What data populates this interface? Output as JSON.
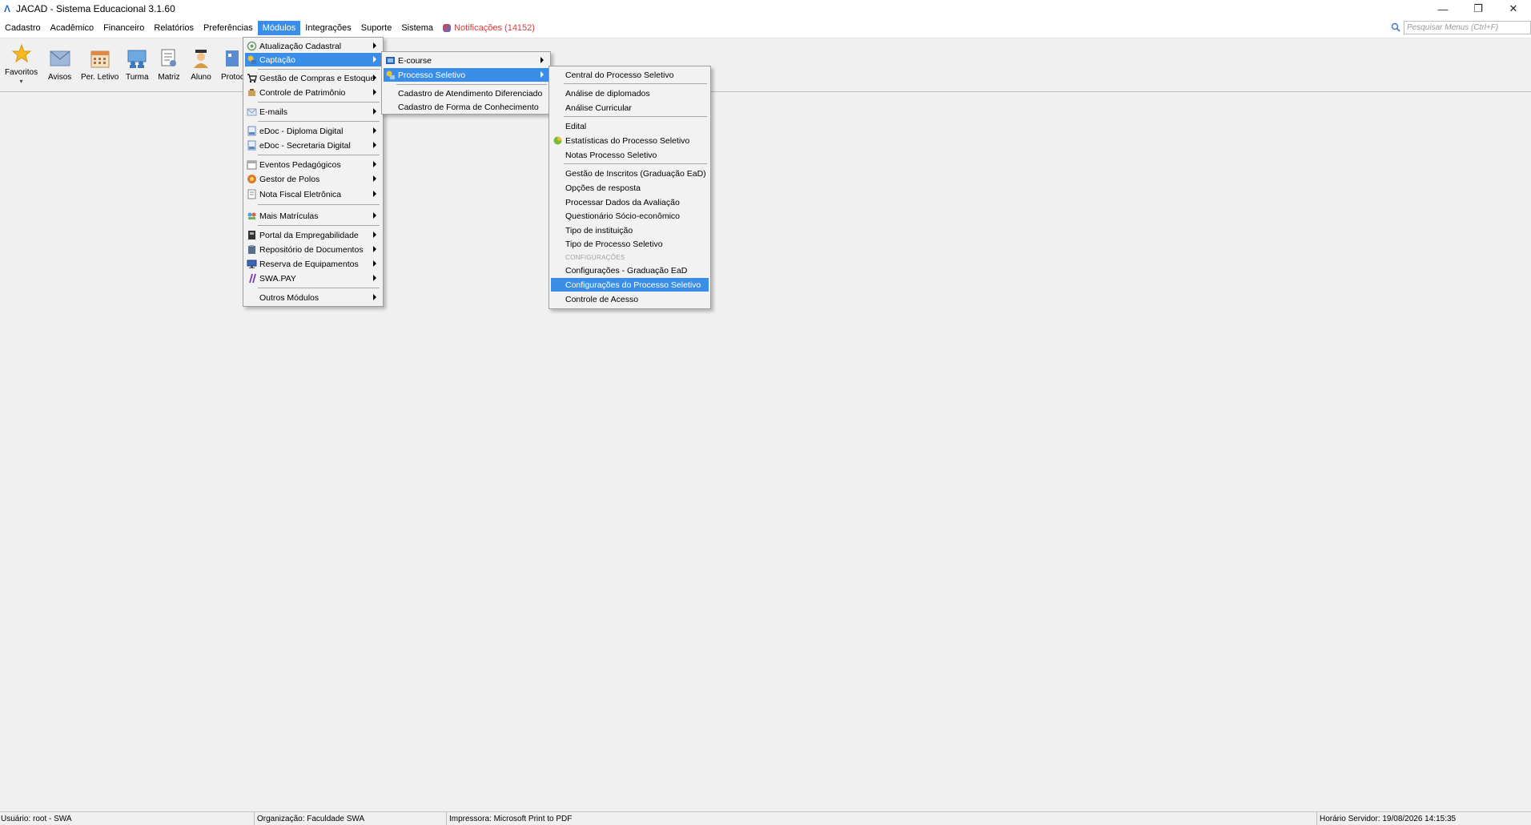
{
  "window": {
    "title": "JACAD - Sistema Educacional 3.1.60",
    "logo_glyph": "Λ",
    "minimize_glyph": "—",
    "restore_glyph": "❐",
    "close_glyph": "✕"
  },
  "menubar": {
    "items": [
      "Cadastro",
      "Acadêmico",
      "Financeiro",
      "Relatórios",
      "Preferências",
      "Módulos",
      "Integrações",
      "Suporte",
      "Sistema"
    ],
    "active_index": 5,
    "notifications_label": "Notificações (14152)",
    "search_placeholder": "Pesquisar Menus (Ctrl+F)"
  },
  "toolbar": {
    "items": [
      {
        "label": "Favoritos",
        "icon": "star-icon"
      },
      {
        "label": "Avisos",
        "icon": "envelope-icon"
      },
      {
        "label": "Per. Letivo",
        "icon": "calendar-icon"
      },
      {
        "label": "Turma",
        "icon": "group-icon"
      },
      {
        "label": "Matriz",
        "icon": "document-icon"
      },
      {
        "label": "Aluno",
        "icon": "student-icon"
      },
      {
        "label": "Protoc",
        "icon": "protocol-icon"
      }
    ],
    "favorites_caret": "▾"
  },
  "modules_menu": {
    "items": [
      {
        "label": "Atualização Cadastral",
        "icon": "refresh-icon"
      },
      {
        "label": "Captação",
        "icon": "capture-icon",
        "highlighted": true
      },
      {
        "label": "Gestão de Compras e Estoque",
        "icon": "cart-icon"
      },
      {
        "label": "Controle de Patrimônio",
        "icon": "asset-icon"
      },
      {
        "label": "E-mails",
        "icon": "email-icon"
      },
      {
        "label": "eDoc - Diploma Digital",
        "icon": "diploma-icon"
      },
      {
        "label": "eDoc - Secretaria Digital",
        "icon": "secretary-icon"
      },
      {
        "label": "Eventos Pedagógicos",
        "icon": "events-icon"
      },
      {
        "label": "Gestor de Polos",
        "icon": "poles-icon"
      },
      {
        "label": "Nota Fiscal Eletrônica",
        "icon": "invoice-icon"
      },
      {
        "label": "Mais Matrículas",
        "icon": "enrollment-icon"
      },
      {
        "label": "Portal da Empregabilidade",
        "icon": "portal-icon"
      },
      {
        "label": "Repositório de Documentos",
        "icon": "repository-icon"
      },
      {
        "label": "Reserva de Equipamentos",
        "icon": "monitor-icon"
      },
      {
        "label": "SWA.PAY",
        "icon": "pay-icon"
      },
      {
        "label": "Outros Módulos",
        "icon": ""
      }
    ]
  },
  "captacao_menu": {
    "items": [
      {
        "label": "E-course",
        "icon": "ecourse-icon",
        "submenu": true
      },
      {
        "label": "Processo Seletivo",
        "icon": "process-icon",
        "submenu": true,
        "highlighted": true
      },
      {
        "label": "Cadastro de Atendimento Diferenciado",
        "icon": ""
      },
      {
        "label": "Cadastro de Forma de Conhecimento",
        "icon": ""
      }
    ]
  },
  "processo_menu": {
    "items": [
      {
        "label": "Central do Processo Seletivo"
      },
      {
        "label": "Análise de diplomados"
      },
      {
        "label": "Análise Curricular"
      },
      {
        "label": "Edital"
      },
      {
        "label": "Estatísticas do Processo Seletivo",
        "icon": "chart-pie-icon"
      },
      {
        "label": "Notas Processo Seletivo"
      },
      {
        "label": "Gestão de Inscritos (Graduação EaD)"
      },
      {
        "label": "Opções de resposta"
      },
      {
        "label": "Processar Dados da Avaliação"
      },
      {
        "label": "Questionário Sócio-econômico"
      },
      {
        "label": "Tipo de instituição"
      },
      {
        "label": "Tipo de Processo Seletivo"
      },
      {
        "label": "Configurações - Graduação EaD"
      },
      {
        "label": "Configurações do Processo Seletivo",
        "highlighted": true
      },
      {
        "label": "Controle de Acesso"
      }
    ],
    "group_label": "CONFIGURAÇÕES"
  },
  "statusbar": {
    "user": "Usuário: root - SWA",
    "organization": "Organização: Faculdade SWA",
    "printer": "Impressora: Microsoft Print to PDF",
    "server_time": "Horário Servidor: 19/08/2026 14:15:35"
  },
  "colors": {
    "highlight": "#3b8ee8",
    "notification": "#d43c3c"
  }
}
